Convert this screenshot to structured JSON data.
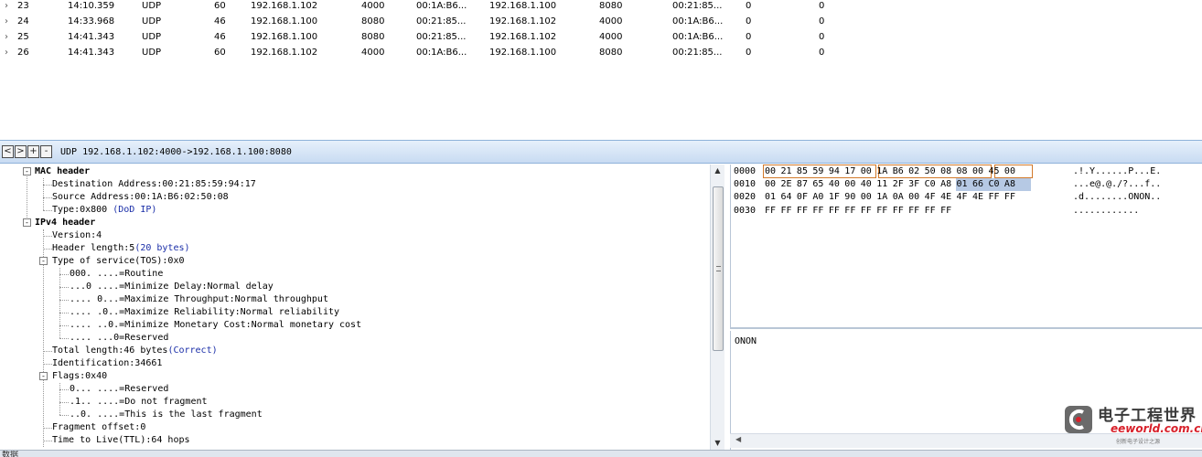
{
  "packets": [
    {
      "no": "23",
      "time": "14:10.359",
      "proto": "UDP",
      "len": "60",
      "src": "192.168.1.102",
      "sport": "4000",
      "smac": "00:1A:B6...",
      "dst": "192.168.1.100",
      "dport": "8080",
      "dmac": "00:21:85...",
      "c1": "0",
      "c2": "0"
    },
    {
      "no": "24",
      "time": "14:33.968",
      "proto": "UDP",
      "len": "46",
      "src": "192.168.1.100",
      "sport": "8080",
      "smac": "00:21:85...",
      "dst": "192.168.1.102",
      "dport": "4000",
      "dmac": "00:1A:B6...",
      "c1": "0",
      "c2": "0"
    },
    {
      "no": "25",
      "time": "14:41.343",
      "proto": "UDP",
      "len": "46",
      "src": "192.168.1.100",
      "sport": "8080",
      "smac": "00:21:85...",
      "dst": "192.168.1.102",
      "dport": "4000",
      "dmac": "00:1A:B6...",
      "c1": "0",
      "c2": "0"
    },
    {
      "no": "26",
      "time": "14:41.343",
      "proto": "UDP",
      "len": "60",
      "src": "192.168.1.102",
      "sport": "4000",
      "smac": "00:1A:B6...",
      "dst": "192.168.1.100",
      "dport": "8080",
      "dmac": "00:21:85...",
      "c1": "0",
      "c2": "0"
    }
  ],
  "toolbar": {
    "back": "<",
    "forward": ">",
    "expand": "+",
    "collapse": "-",
    "title": "UDP 192.168.1.102:4000->192.168.1.100:8080"
  },
  "tree": [
    {
      "text": "MAC header",
      "note": "",
      "bold": true,
      "expander": "-"
    },
    {
      "text": "Destination Address:00:21:85:59:94:17",
      "note": "",
      "bold": false,
      "expander": ""
    },
    {
      "text": "Source Address:00:1A:B6:02:50:08",
      "note": "",
      "bold": false,
      "expander": ""
    },
    {
      "text": "Type:0x800 ",
      "note": "(DoD IP)",
      "bold": false,
      "expander": ""
    },
    {
      "text": "IPv4 header",
      "note": "",
      "bold": true,
      "expander": "-"
    },
    {
      "text": "Version:4",
      "note": "",
      "bold": false,
      "expander": ""
    },
    {
      "text": "Header length:5",
      "note": "(20 bytes)",
      "bold": false,
      "expander": ""
    },
    {
      "text": "Type of service(TOS):0x0",
      "note": "",
      "bold": false,
      "expander": "-"
    },
    {
      "text": "000. ....=Routine",
      "note": "",
      "bold": false,
      "expander": ""
    },
    {
      "text": "...0 ....=Minimize Delay:Normal delay",
      "note": "",
      "bold": false,
      "expander": ""
    },
    {
      "text": ".... 0...=Maximize Throughput:Normal throughput",
      "note": "",
      "bold": false,
      "expander": ""
    },
    {
      "text": ".... .0..=Maximize Reliability:Normal reliability",
      "note": "",
      "bold": false,
      "expander": ""
    },
    {
      "text": ".... ..0.=Minimize Monetary Cost:Normal monetary cost",
      "note": "",
      "bold": false,
      "expander": ""
    },
    {
      "text": ".... ...0=Reserved",
      "note": "",
      "bold": false,
      "expander": ""
    },
    {
      "text": "Total length:46 bytes",
      "note": "(Correct)",
      "bold": false,
      "expander": ""
    },
    {
      "text": "Identification:34661",
      "note": "",
      "bold": false,
      "expander": ""
    },
    {
      "text": "Flags:0x40",
      "note": "",
      "bold": false,
      "expander": "-"
    },
    {
      "text": "0... ....=Reserved",
      "note": "",
      "bold": false,
      "expander": ""
    },
    {
      "text": ".1.. ....=Do not fragment",
      "note": "",
      "bold": false,
      "expander": ""
    },
    {
      "text": "..0. ....=This is the last fragment",
      "note": "",
      "bold": false,
      "expander": ""
    },
    {
      "text": "Fragment offset:0",
      "note": "",
      "bold": false,
      "expander": ""
    },
    {
      "text": "Time to Live(TTL):64 hops",
      "note": "",
      "bold": false,
      "expander": ""
    }
  ],
  "hex": [
    {
      "offset": "0000",
      "bytes": "00 21 85 59 94 17 00 1A B6 02 50 08 08 00 45 00",
      "ascii": ".!.Y......P...E."
    },
    {
      "offset": "0010",
      "bytes": "00 2E 87 65 40 00 40 11 2F 3F C0 A8 01 66 C0 A8",
      "ascii": "...e@.@./?...f.."
    },
    {
      "offset": "0020",
      "bytes": "01 64 0F A0 1F 90 00 1A 0A 00 4F 4E 4F 4E FF FF",
      "ascii": ".d........ONON.."
    },
    {
      "offset": "0030",
      "bytes": "FF FF FF FF FF FF FF FF FF FF FF FF",
      "ascii": "............"
    }
  ],
  "text_view": {
    "content": "ONON"
  },
  "status": {
    "text": "数据"
  },
  "watermark": {
    "cn": "电子工程世界",
    "en": "eeworld.com.cn",
    "sub": "创新电子设计之源"
  },
  "colors": {
    "highlight_box": "#d2792a",
    "selection": "#b6c9e4",
    "note_text": "#1a2ea8",
    "toolbar": "#c8dbf2"
  }
}
